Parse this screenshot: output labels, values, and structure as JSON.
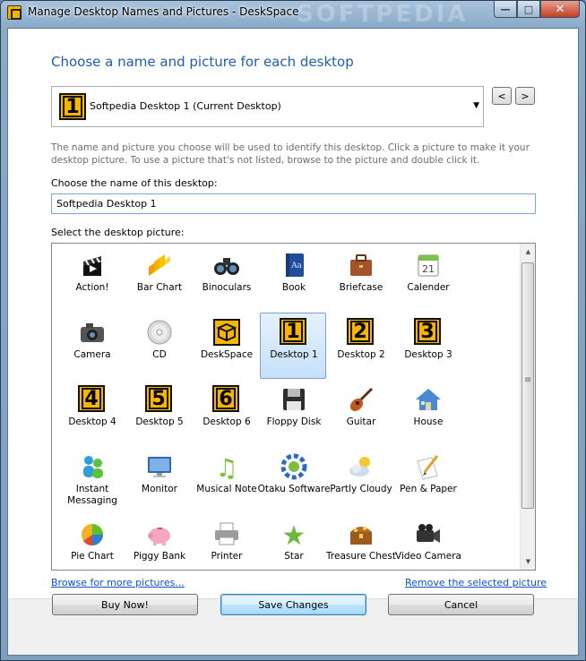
{
  "window": {
    "title": "Manage Desktop Names and Pictures - DeskSpace",
    "watermark": "SOFTPEDIA",
    "min": "—",
    "max": "□",
    "close": "✕"
  },
  "heading": "Choose a name and picture for each desktop",
  "desktop_select": {
    "number": "1",
    "value": "Softpedia Desktop 1 (Current Desktop)",
    "prev": "<",
    "next": ">"
  },
  "description": "The name and picture you choose will be used to identify this desktop. Click a picture to make it your desktop picture. To use a picture that's not listed, browse to the picture and double click it.",
  "name_label": "Choose the name of this desktop:",
  "name_value": "Softpedia Desktop 1",
  "picture_label": "Select the desktop picture:",
  "pictures": [
    {
      "label": "Action!",
      "icon": "clapperboard-icon"
    },
    {
      "label": "Bar Chart",
      "icon": "bar-chart-icon"
    },
    {
      "label": "Binoculars",
      "icon": "binoculars-icon"
    },
    {
      "label": "Book",
      "icon": "book-icon"
    },
    {
      "label": "Briefcase",
      "icon": "briefcase-icon"
    },
    {
      "label": "Calender",
      "icon": "calendar-icon",
      "glyph": "21"
    },
    {
      "label": "Camera",
      "icon": "camera-icon"
    },
    {
      "label": "CD",
      "icon": "cd-icon"
    },
    {
      "label": "DeskSpace",
      "icon": "deskspace-icon"
    },
    {
      "label": "Desktop 1",
      "icon": "desktop-1-icon",
      "num": "1",
      "selected": true
    },
    {
      "label": "Desktop 2",
      "icon": "desktop-2-icon",
      "num": "2"
    },
    {
      "label": "Desktop 3",
      "icon": "desktop-3-icon",
      "num": "3"
    },
    {
      "label": "Desktop 4",
      "icon": "desktop-4-icon",
      "num": "4"
    },
    {
      "label": "Desktop 5",
      "icon": "desktop-5-icon",
      "num": "5"
    },
    {
      "label": "Desktop 6",
      "icon": "desktop-6-icon",
      "num": "6"
    },
    {
      "label": "Floppy Disk",
      "icon": "floppy-disk-icon"
    },
    {
      "label": "Guitar",
      "icon": "guitar-icon"
    },
    {
      "label": "House",
      "icon": "house-icon"
    },
    {
      "label": "Instant Messaging",
      "icon": "instant-messaging-icon"
    },
    {
      "label": "Monitor",
      "icon": "monitor-icon"
    },
    {
      "label": "Musical Note",
      "icon": "musical-note-icon",
      "glyph": "♫"
    },
    {
      "label": "Otaku Software",
      "icon": "otaku-software-icon"
    },
    {
      "label": "Partly Cloudy",
      "icon": "partly-cloudy-icon"
    },
    {
      "label": "Pen & Paper",
      "icon": "pen-paper-icon"
    },
    {
      "label": "Pie Chart",
      "icon": "pie-chart-icon"
    },
    {
      "label": "Piggy Bank",
      "icon": "piggy-bank-icon"
    },
    {
      "label": "Printer",
      "icon": "printer-icon"
    },
    {
      "label": "Star",
      "icon": "star-icon",
      "glyph": "★"
    },
    {
      "label": "Treasure Chest",
      "icon": "treasure-chest-icon"
    },
    {
      "label": "Video Camera",
      "icon": "video-camera-icon"
    }
  ],
  "links": {
    "browse": "Browse for more pictures...",
    "remove": "Remove the selected picture"
  },
  "buttons": {
    "buy": "Buy Now!",
    "save": "Save Changes",
    "cancel": "Cancel"
  }
}
